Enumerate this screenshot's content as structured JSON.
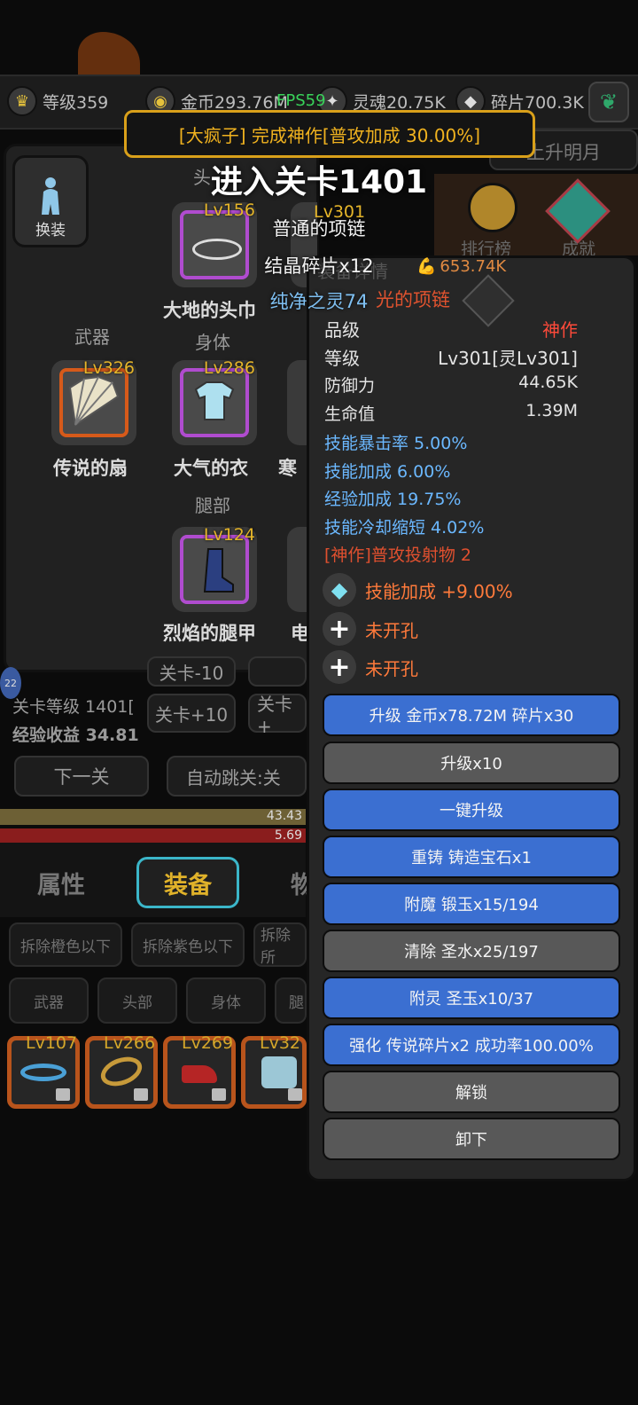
{
  "resources": [
    {
      "icon": "crown-icon",
      "label": "等级359"
    },
    {
      "icon": "coin-icon",
      "label": "金币293.76M"
    },
    {
      "icon": "soul-icon",
      "label": "灵魂20.75K"
    },
    {
      "icon": "shard-icon",
      "label": "碎片700.3K"
    }
  ],
  "fps": "FPS59",
  "toast": "[大疯子] 完成神作[普攻加成 30.00%]",
  "stage_banner": "进入关卡1401",
  "drops": [
    "普通的项链",
    "结晶碎片x12",
    "纯净之灵74"
  ],
  "header_partial": {
    "rise_moon": "上升明月",
    "ranking": "排行榜",
    "achievement": "成就"
  },
  "left_panel": {
    "change_outfit": "换装",
    "head_label": "头",
    "head_item": {
      "lv": "Lv156",
      "name": "大地的头巾"
    },
    "head_item2_partial": "Lv301",
    "weapon_label": "武器",
    "weapon": {
      "lv": "Lv326",
      "name": "传说的扇"
    },
    "body_label": "身体",
    "body": {
      "lv": "Lv286",
      "name": "大气的衣"
    },
    "body2_name_partial": "寒",
    "leg_label": "腿部",
    "leg": {
      "lv": "Lv124",
      "name": "烈焰的腿甲"
    },
    "leg2_name_partial": "电"
  },
  "stage_info": {
    "badge": "22",
    "stage_level": "关卡等级 1401[",
    "exp_income": "经验收益 34.81",
    "btn_minus10": "关卡-10",
    "btn_plus10": "关卡+10",
    "btn_plus10b": "关卡+",
    "next": "下一关",
    "auto": "自动跳关:关",
    "bar1": "43.43",
    "bar2": "5.69"
  },
  "tabs": {
    "attr": "属性",
    "equip": "装备",
    "item_partial": "物"
  },
  "filters": {
    "orange": "拆除橙色以下",
    "purple": "拆除紫色以下",
    "all_partial": "拆除所"
  },
  "categories": [
    "武器",
    "头部",
    "身体",
    "腿"
  ],
  "bag": [
    {
      "lv": "Lv107",
      "icon": "bracelet-icon"
    },
    {
      "lv": "Lv266",
      "icon": "ring-icon"
    },
    {
      "lv": "Lv269",
      "icon": "boots-icon"
    },
    {
      "lv": "Lv32",
      "icon": "armor-icon"
    }
  ],
  "detail": {
    "header_partial": "装备详情",
    "power": "653.74K",
    "item_name_partial": "光的项链",
    "rows": [
      {
        "k": "品级",
        "v": "神作",
        "color": "#ff4a3a"
      },
      {
        "k": "等级",
        "v": "Lv301[灵Lv301]",
        "color": "#e4e4e4"
      },
      {
        "k": "防御力",
        "v": "44.65K",
        "color": "#e4e4e4"
      },
      {
        "k": "生命值",
        "v": "1.39M",
        "color": "#e4e4e4"
      }
    ],
    "attrs": [
      "技能暴击率 5.00%",
      "技能加成 6.00%",
      "经验加成 19.75%",
      "技能冷却缩短 4.02%"
    ],
    "special": "[神作]普攻投射物 2",
    "gem": "技能加成 +9.00%",
    "slot1": "未开孔",
    "slot2": "未开孔",
    "buttons": [
      {
        "label": "升级 金币x78.72M 碎片x30",
        "style": "blue"
      },
      {
        "label": "升级x10",
        "style": "gray"
      },
      {
        "label": "一键升级",
        "style": "blue"
      },
      {
        "label": "重铸 铸造宝石x1",
        "style": "blue"
      },
      {
        "label": "附魔 锻玉x15/194",
        "style": "blue"
      },
      {
        "label": "清除 圣水x25/197",
        "style": "gray"
      },
      {
        "label": "附灵 圣玉x10/37",
        "style": "blue"
      },
      {
        "label": "强化 传说碎片x2 成功率100.00%",
        "style": "blue"
      },
      {
        "label": "解锁",
        "style": "gray"
      },
      {
        "label": "卸下",
        "style": "gray"
      }
    ]
  }
}
